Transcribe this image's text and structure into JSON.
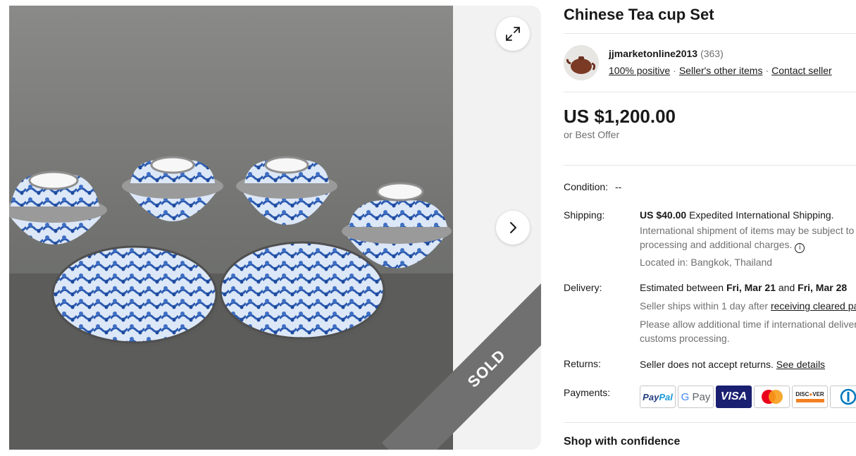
{
  "listing": {
    "title": "Chinese Tea cup Set",
    "sold_badge": "SOLD"
  },
  "seller": {
    "name": "jjmarketonline2013",
    "feedback_count": "(363)",
    "positive_link": "100% positive",
    "other_items_link": "Seller's other items",
    "contact_link": "Contact seller",
    "separator": "·"
  },
  "pricing": {
    "price": "US $1,200.00",
    "best_offer": "or Best Offer"
  },
  "details": {
    "condition": {
      "label": "Condition:",
      "value": "--"
    },
    "shipping": {
      "label": "Shipping:",
      "price": "US $40.00",
      "method": "Expedited International Shipping.",
      "note_line1": "International shipment of items may be subject to customs",
      "note_line2": "processing and additional charges.",
      "location": "Located in: Bangkok, Thailand"
    },
    "delivery": {
      "label": "Delivery:",
      "prefix": "Estimated between",
      "date_start": "Fri, Mar 21",
      "and": "and",
      "date_end": "Fri, Mar 28",
      "ships_prefix": "Seller ships within 1 day after",
      "ships_link": "receiving cleared payment.",
      "allow_line1": "Please allow additional time if international delivery is subject to",
      "allow_line2": "customs processing."
    },
    "returns": {
      "label": "Returns:",
      "text": "Seller does not accept returns.",
      "link": "See details"
    },
    "payments": {
      "label": "Payments:",
      "methods": [
        "PayPal",
        "Google Pay",
        "Visa",
        "Mastercard",
        "Discover",
        "Diners Club"
      ]
    }
  },
  "shop_confidence": "Shop with confidence",
  "colors": {
    "text": "#191919",
    "muted": "#707070",
    "ribbon": "#707070",
    "gallery_bg": "#f2f2f2"
  }
}
